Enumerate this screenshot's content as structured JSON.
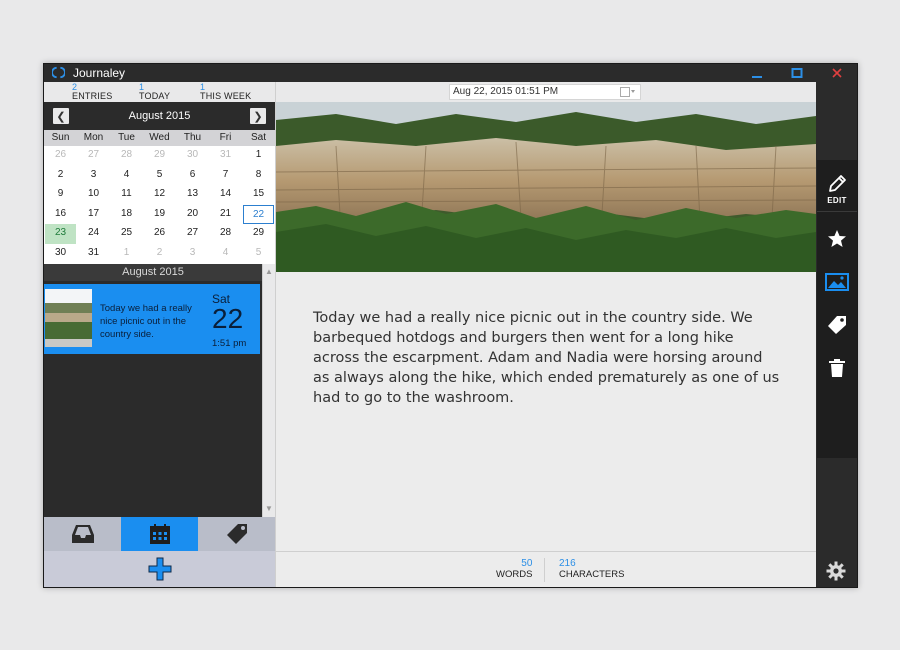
{
  "app": {
    "title": "Journaley",
    "icon": "journaley-logo-icon"
  },
  "window_controls": {
    "minimize": "minimize-icon",
    "maximize": "maximize-icon",
    "close": "close-icon"
  },
  "stats": [
    {
      "value": "2",
      "label": "ENTRIES"
    },
    {
      "value": "1",
      "label": "TODAY"
    },
    {
      "value": "1",
      "label": "THIS WEEK"
    }
  ],
  "calendar": {
    "month_label": "August 2015",
    "prev_icon": "chevron-left-icon",
    "next_icon": "chevron-right-icon",
    "weekdays": [
      "Sun",
      "Mon",
      "Tue",
      "Wed",
      "Thu",
      "Fri",
      "Sat"
    ],
    "days": [
      {
        "d": "26",
        "o": true
      },
      {
        "d": "27",
        "o": true
      },
      {
        "d": "28",
        "o": true
      },
      {
        "d": "29",
        "o": true
      },
      {
        "d": "30",
        "o": true
      },
      {
        "d": "31",
        "o": true
      },
      {
        "d": "1"
      },
      {
        "d": "2"
      },
      {
        "d": "3"
      },
      {
        "d": "4"
      },
      {
        "d": "5"
      },
      {
        "d": "6"
      },
      {
        "d": "7"
      },
      {
        "d": "8"
      },
      {
        "d": "9"
      },
      {
        "d": "10"
      },
      {
        "d": "11"
      },
      {
        "d": "12"
      },
      {
        "d": "13"
      },
      {
        "d": "14"
      },
      {
        "d": "15"
      },
      {
        "d": "16"
      },
      {
        "d": "17"
      },
      {
        "d": "18"
      },
      {
        "d": "19"
      },
      {
        "d": "20"
      },
      {
        "d": "21"
      },
      {
        "d": "22",
        "today": true
      },
      {
        "d": "23",
        "selected": true
      },
      {
        "d": "24"
      },
      {
        "d": "25"
      },
      {
        "d": "26"
      },
      {
        "d": "27"
      },
      {
        "d": "28"
      },
      {
        "d": "29"
      },
      {
        "d": "30"
      },
      {
        "d": "31"
      },
      {
        "d": "1",
        "o": true
      },
      {
        "d": "2",
        "o": true
      },
      {
        "d": "3",
        "o": true
      },
      {
        "d": "4",
        "o": true
      },
      {
        "d": "5",
        "o": true
      }
    ]
  },
  "entry_list": {
    "group_label": "August 2015",
    "entries": [
      {
        "preview": "Today we had a really nice picnic out in the country side.",
        "weekday": "Sat",
        "day": "22",
        "time": "1:51 pm"
      }
    ]
  },
  "bottom_tabs": [
    {
      "icon": "inbox-icon"
    },
    {
      "icon": "calendar-icon",
      "active": true
    },
    {
      "icon": "tag-icon"
    }
  ],
  "add_button": {
    "icon": "plus-icon"
  },
  "entry": {
    "datetime": "Aug 22, 2015 01:51 PM",
    "date_picker_icon": "calendar-dropdown-icon",
    "body": "Today we had a really nice picnic out in the country side. We barbequed hotdogs and burgers then went for a long hike across the escarpment. Adam and Nadia were horsing around as always along the hike, which ended prematurely as one of us had to go to the washroom."
  },
  "counts": {
    "words": "50",
    "words_label": "WORDS",
    "characters": "216",
    "characters_label": "CHARACTERS"
  },
  "toolbar": {
    "edit_label": "EDIT",
    "tools": [
      "pencil-icon",
      "star-icon",
      "image-icon",
      "tag-icon",
      "trash-icon"
    ],
    "settings_icon": "gear-icon"
  },
  "colors": {
    "accent": "#1a8ef0",
    "dark": "#2b2b2b",
    "selected_day": "#bfe3c4"
  }
}
